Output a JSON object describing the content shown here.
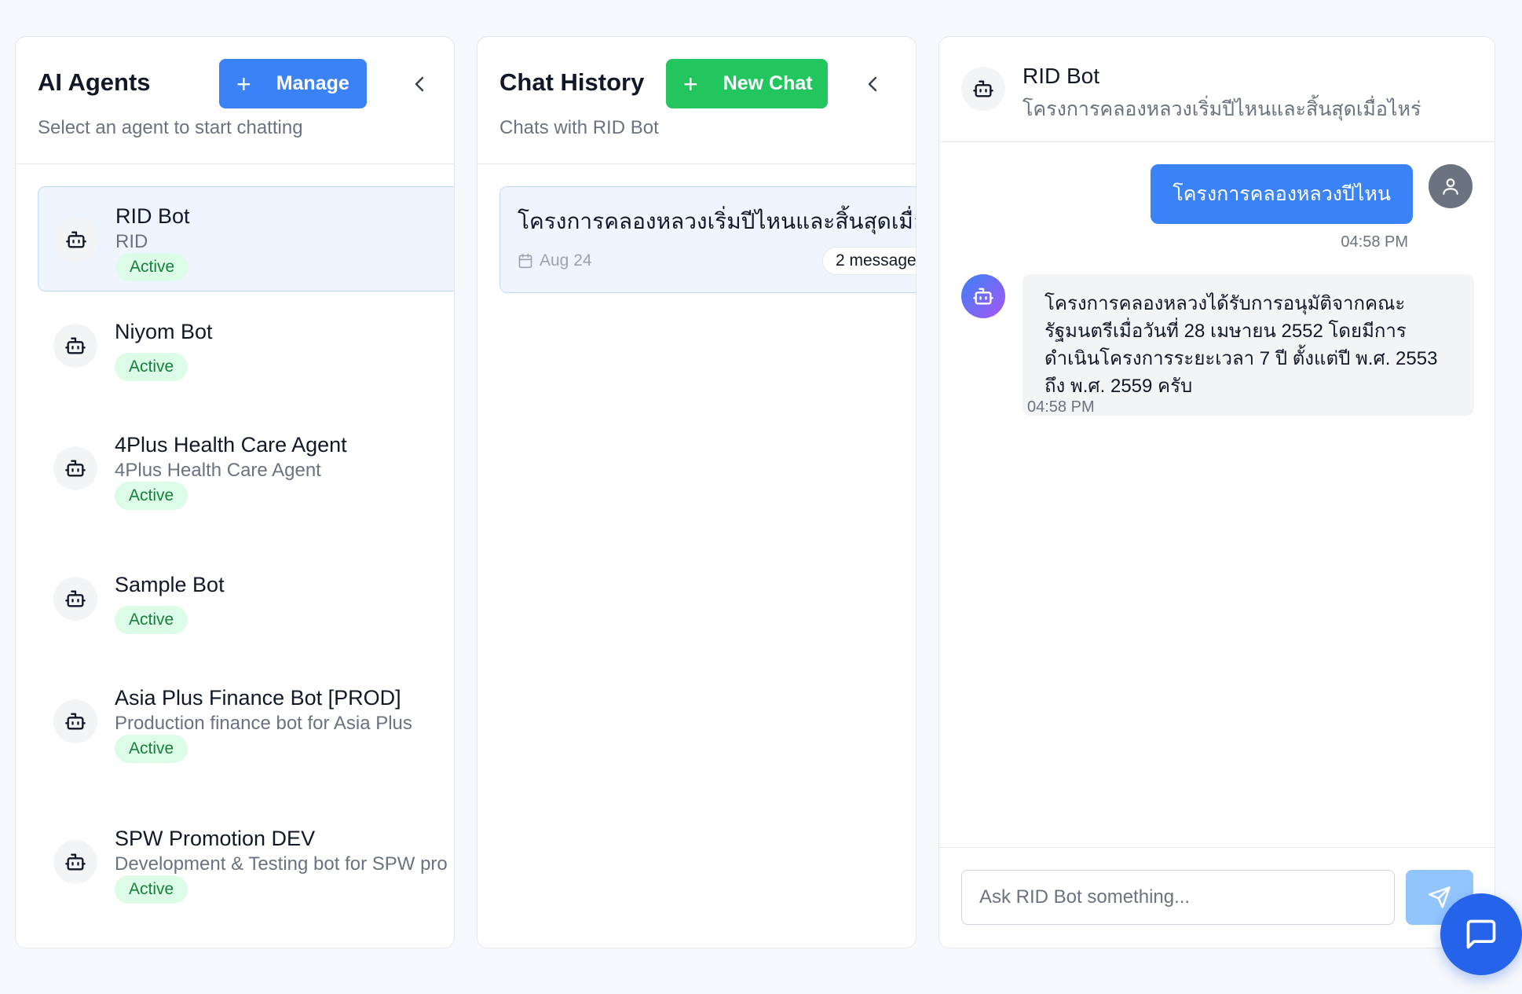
{
  "agents_panel": {
    "title": "AI Agents",
    "manage_label": "Manage",
    "subtitle": "Select an agent to start chatting",
    "agents": [
      {
        "name": "RID Bot",
        "desc": "RID",
        "status": "Active",
        "selected": true
      },
      {
        "name": "Niyom Bot",
        "desc": "",
        "status": "Active"
      },
      {
        "name": "4Plus Health Care Agent",
        "desc": "4Plus Health Care Agent",
        "status": "Active"
      },
      {
        "name": "Sample Bot",
        "desc": "",
        "status": "Active"
      },
      {
        "name": "Asia Plus Finance Bot [PROD]",
        "desc": "Production finance bot for Asia Plus",
        "status": "Active"
      },
      {
        "name": "SPW Promotion DEV",
        "desc": "Development & Testing bot for SPW pro",
        "status": "Active"
      }
    ]
  },
  "history_panel": {
    "title": "Chat History",
    "new_chat_label": "New Chat",
    "subtitle": "Chats with RID Bot",
    "items": [
      {
        "title": "โครงการคลองหลวงเริ่มปีไหนและสิ้นสุดเมื่อไห",
        "date": "Aug 24",
        "count": "2 message"
      }
    ]
  },
  "chat": {
    "bot_name": "RID Bot",
    "conversation_title": "โครงการคลองหลวงเริ่มปีไหนและสิ้นสุดเมื่อไหร่",
    "messages": [
      {
        "role": "user",
        "text": "โครงการคลองหลวงปีไหน",
        "time": "04:58 PM"
      },
      {
        "role": "bot",
        "text": "โครงการคลองหลวงได้รับการอนุมัติจากคณะรัฐมนตรีเมื่อวันที่ 28 เมษายน 2552 โดยมีการดำเนินโครงการระยะเวลา 7 ปี ตั้งแต่ปี พ.ศ. 2553 ถึง พ.ศ. 2559 ครับ",
        "time": "04:58 PM"
      }
    ],
    "input_placeholder": "Ask RID Bot something..."
  },
  "colors": {
    "primary": "#3b82f6",
    "success": "#22c55e",
    "badge_bg": "#dcfce7",
    "badge_text": "#15803d",
    "selected_bg": "#eff5ff"
  },
  "icons": {
    "agent": "bot-icon",
    "user": "user-icon",
    "send": "send-icon",
    "calendar": "calendar-icon",
    "collapse": "chevron-left-icon",
    "fab": "chat-bubble-icon"
  }
}
